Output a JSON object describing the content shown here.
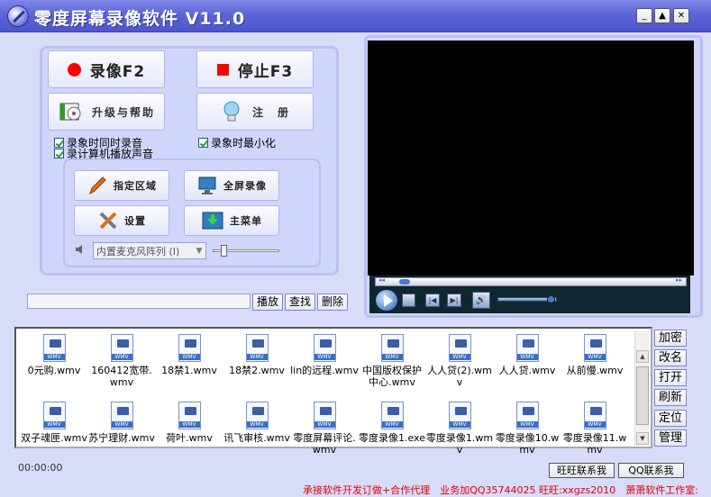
{
  "app": {
    "title": "零度屏幕录像软件 V11.0"
  },
  "window_buttons": {
    "minimize": "_",
    "maximize": "▲",
    "close": "✕"
  },
  "main_buttons": {
    "record": "录像F2",
    "stop": "停止F3",
    "upgrade_help": "升级与帮助",
    "register": "注　册"
  },
  "options": {
    "record_audio": "录象时同时录音",
    "minimize_on_record": "录象时最小化",
    "record_system_sound": "录计算机播放声音"
  },
  "tools": {
    "select_area": "指定区域",
    "fullscreen": "全屏录像",
    "settings": "设置",
    "main_menu": "主菜单"
  },
  "audio": {
    "device": "内置麦克风阵列 (I)",
    "volume_pct": 12
  },
  "file_actions": {
    "play": "播放",
    "find": "查找",
    "delete": "删除"
  },
  "player": {
    "progress_pct": 2,
    "volume_pct": 90
  },
  "files": [
    "0元购.wmv",
    "160412宽带.wmv",
    "18禁1.wmv",
    "18禁2.wmv",
    "lin的远程.wmv",
    "中国版权保护中心.wmv",
    "人人贷(2).wmv",
    "人人贷.wmv",
    "从前慢.wmv",
    "双子魂匣.wmv",
    "苏宁理财.wmv",
    "荷叶.wmv",
    "讯飞审核.wmv",
    "零度屏幕评论.wmv",
    "零度录像1.exe",
    "零度录像1.wmv",
    "零度录像10.wmv",
    "零度录像11.wmv"
  ],
  "side_buttons": [
    "加密",
    "改名",
    "打开",
    "刷新",
    "定位",
    "管理"
  ],
  "status": {
    "time": "00:00:00",
    "wangwang": "旺旺联系我",
    "qq": "QQ联系我",
    "footer": "承接软件开发订做+合作代理　业务加QQ35744025 旺旺:xxgzs2010　萧萧软件工作室:"
  }
}
